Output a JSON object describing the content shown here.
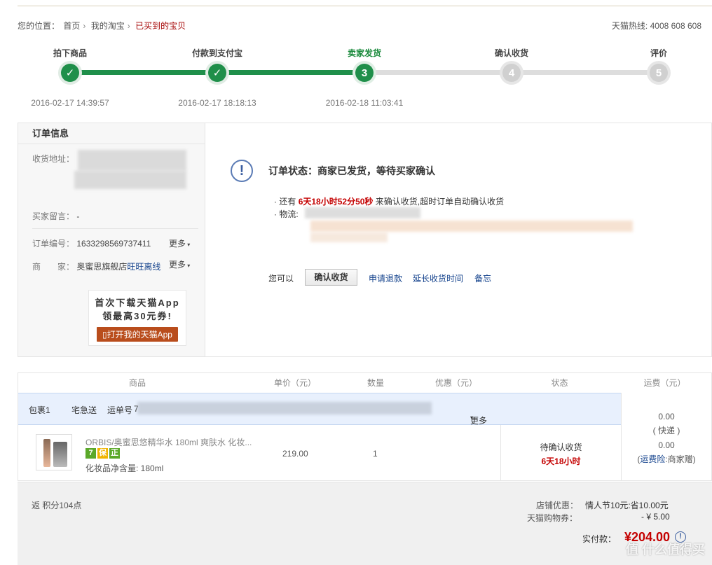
{
  "breadcrumb": {
    "prefix": "您的位置：",
    "items": [
      "首页",
      "我的淘宝",
      "已买到的宝贝"
    ]
  },
  "hotline": "天猫热线: 4008 608 608",
  "steps": [
    {
      "label": "拍下商品",
      "node": "✓",
      "time": "2016-02-17 14:39:57"
    },
    {
      "label": "付款到支付宝",
      "node": "✓",
      "time": "2016-02-17 18:18:13"
    },
    {
      "label": "卖家发货",
      "node": "3",
      "time": "2016-02-18 11:03:41"
    },
    {
      "label": "确认收货",
      "node": "4",
      "time": ""
    },
    {
      "label": "评价",
      "node": "5",
      "time": ""
    }
  ],
  "order_info": {
    "title": "订单信息",
    "address_label": "收货地址：",
    "message_label": "买家留言：",
    "message_value": "-",
    "order_no_label": "订单编号：",
    "order_no": "1633298569737411",
    "more": "更多",
    "seller_label": "商　　家：",
    "seller": "奥蜜思旗舰店",
    "wangwang": "旺旺离线"
  },
  "promo": {
    "line1": "首次下载天猫App",
    "line2": "领最高30元券!",
    "button": "打开我的天猫App"
  },
  "status": {
    "title": "订单状态：商家已发货，等待买家确认",
    "countdown_prefix": "还有",
    "countdown": "6天18小时52分50秒",
    "countdown_suffix": "来确认收货,超时订单自动确认收货",
    "logistics_label": "物流:",
    "you_can": "您可以",
    "confirm_button": "确认收货",
    "refund": "申请退款",
    "extend": "延长收货时间",
    "memo": "备忘"
  },
  "goods_table": {
    "headers": [
      "商品",
      "单价（元）",
      "数量",
      "优惠（元）",
      "状态",
      "运费（元）"
    ],
    "package": "包裹1",
    "courier": "宅急送",
    "tracking_label": "运单号",
    "tracking_partial": "7",
    "more": "更多",
    "product_name": "ORBIS/奥蜜思悠精华水 180ml 爽肤水 化妆...",
    "badges": [
      {
        "text": "7",
        "color": "#5aa829"
      },
      {
        "text": "保",
        "color": "#f0b400"
      },
      {
        "text": "正",
        "color": "#5aa829"
      }
    ],
    "spec": "化妆品净含量:   180ml",
    "price": "219.00",
    "qty": "1",
    "item_status": "待确认收货",
    "item_countdown": "6天18小时",
    "shipping_fee": "0.00",
    "shipping_type": "( 快递 )",
    "insurance_fee": "0.00",
    "insurance_link": "运费险",
    "insurance_suffix": ":商家赠)",
    "insurance_prefix": "("
  },
  "summary": {
    "points": "返 积分104点",
    "shop_discount_label": "店铺优惠：",
    "shop_discount": "情人节10元:省10.00元",
    "coupon_label": "天猫购物券：",
    "coupon": "- ¥ 5.00",
    "total_label": "实付款：",
    "total": "¥204.00"
  },
  "watermark": "值 什么值得买"
}
